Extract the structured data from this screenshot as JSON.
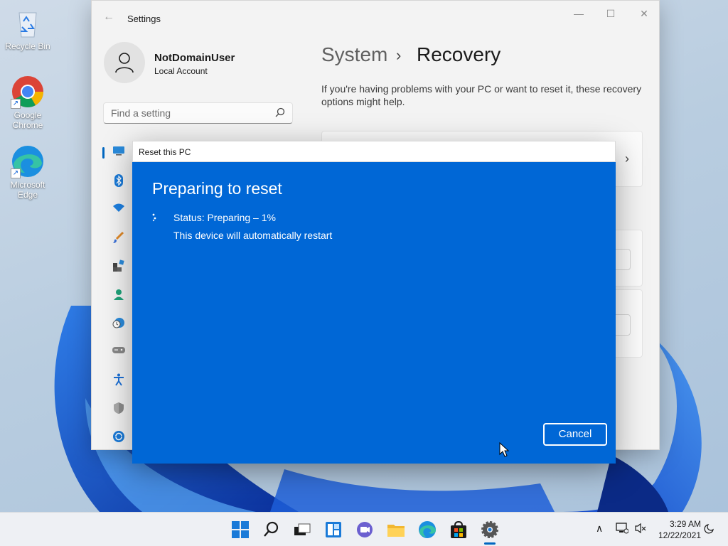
{
  "desktop": {
    "icons": [
      {
        "label": "Recycle Bin",
        "icon": "recycle-bin-icon"
      },
      {
        "label": "Google Chrome",
        "icon": "chrome-icon"
      },
      {
        "label": "Microsoft Edge",
        "icon": "edge-icon"
      }
    ]
  },
  "settings": {
    "title": "Settings",
    "user": {
      "name": "NotDomainUser",
      "type": "Local Account"
    },
    "search_placeholder": "Find a setting",
    "breadcrumb": {
      "parent": "System",
      "separator": "›",
      "current": "Recovery"
    },
    "intro": "If you're having problems with your PC or want to reset it, these recovery options might help.",
    "nav_icons": [
      "system-icon",
      "bluetooth-icon",
      "network-icon",
      "personalization-icon",
      "apps-icon",
      "accounts-icon",
      "time-language-icon",
      "gaming-icon",
      "accessibility-icon",
      "privacy-security-icon",
      "windows-update-icon"
    ]
  },
  "dialog": {
    "title": "Reset this PC",
    "heading": "Preparing to reset",
    "status": "Status: Preparing – 1%",
    "progress_percent": 1,
    "restart_note": "This device will automatically restart",
    "cancel_label": "Cancel"
  },
  "taskbar": {
    "apps": [
      "start-icon",
      "search-icon",
      "task-view-icon",
      "widgets-icon",
      "chat-icon",
      "file-explorer-icon",
      "edge-icon",
      "store-icon",
      "settings-icon"
    ],
    "active_app": "settings-icon",
    "tray": [
      "show-hidden-icons-chevron",
      "network-icon",
      "volume-muted-icon",
      "notifications-icon"
    ],
    "time": "3:29 AM",
    "date": "12/22/2021"
  },
  "colors": {
    "accent": "#0067c0",
    "dialog_bg": "#0067d6"
  }
}
